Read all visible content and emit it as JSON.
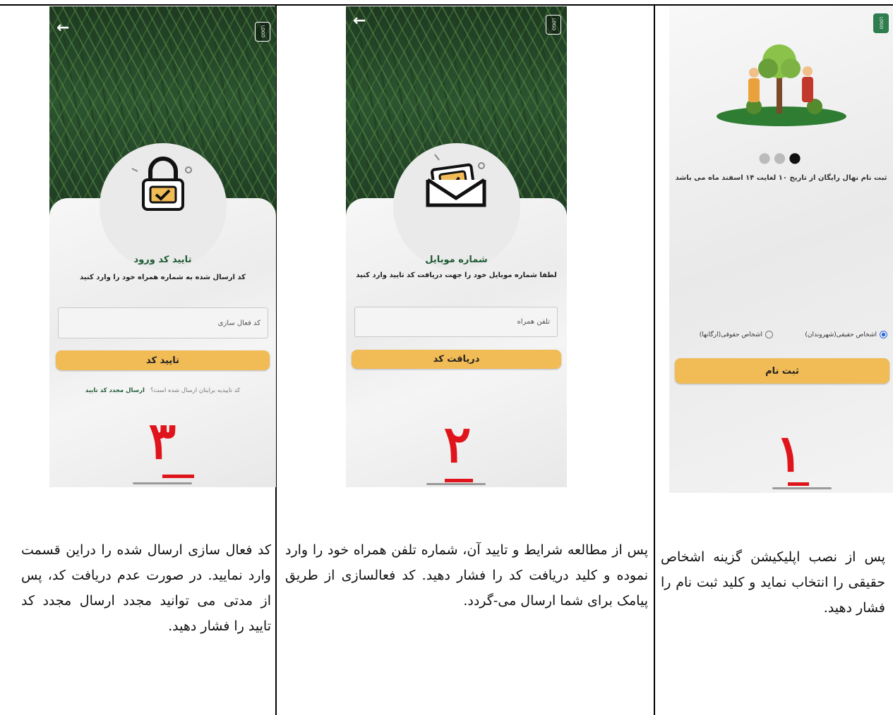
{
  "col3": {
    "screen_title": "تایید کد ورود",
    "screen_subtitle": "کد ارسال شده به شماره همراه خود را وارد کنید",
    "input_placeholder": "کد فعال سازی",
    "button_label": "تایید کد",
    "resend_question": "کد تاییدیه برایتان ارسال شده است؟",
    "resend_link": "ارسال مجدد کد تایید",
    "step_number": "۳",
    "caption": "کد فعال سازی ارسال شده را دراین قسمت وارد نمایید. در صورت عدم دریافت کد، پس از مدتی می توانید مجدد ارسال مجدد کد تایید را فشار دهید."
  },
  "col2": {
    "screen_title": "شماره موبایل",
    "screen_subtitle": "لطفا شماره موبایل خود را جهت دریافت کد تایید وارد کنید",
    "input_placeholder": "تلفن همراه",
    "button_label": "دریافت کد",
    "step_number": "۲",
    "caption": "پس از مطالعه شرایط و تایید آن، شماره تلفن همراه خود را وارد نموده و کلید دریافت کد را فشار دهید. کد فعالسازی از طریق پیامک برای شما ارسال می-گردد."
  },
  "col1": {
    "slide_text": "ثبت نام نهال رایگان از تاریخ ۱۰ لغایت ۱۴ اسفند ماه می باشد",
    "radio_real": "اشخاص حقیقی(شهروندان)",
    "radio_legal": "اشخاص حقوقی(ارگانها)",
    "button_label": "ثبت نام",
    "step_number": "۱",
    "caption": "پس از نصب اپلیکیشن گزینه اشخاص حقیقی را انتخاب نماید و کلید ثبت نام را فشار دهید."
  },
  "icons": [
    "back-arrow-icon",
    "app-logo-icon",
    "lock-icon",
    "envelope-icon",
    "gardeners-illustration"
  ],
  "colors": {
    "button": "#f1bb55",
    "title_green": "#1d5a33",
    "step_red": "#e0141b"
  }
}
